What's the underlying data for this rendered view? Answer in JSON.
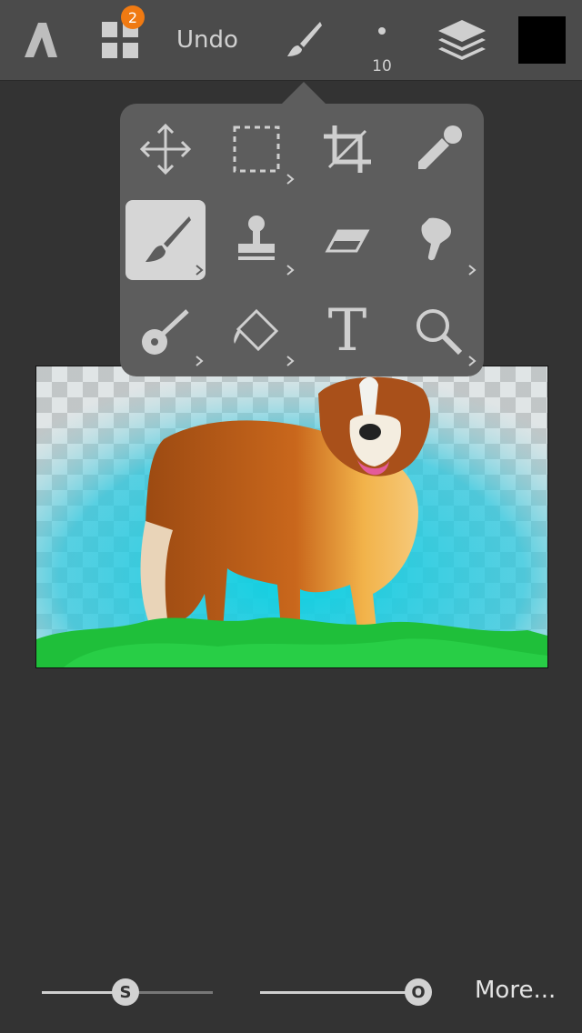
{
  "toolbar": {
    "layers_badge": "2",
    "undo_label": "Undo",
    "brush_size": "10",
    "current_color": "#000000",
    "icons": [
      "app-logo-icon",
      "grid-icon",
      "brush-icon",
      "layers-icon"
    ]
  },
  "tools_popup": {
    "tools": [
      {
        "name": "move",
        "icon": "move-icon",
        "has_submenu": false
      },
      {
        "name": "select",
        "icon": "selection-icon",
        "has_submenu": true
      },
      {
        "name": "crop",
        "icon": "crop-icon",
        "has_submenu": false
      },
      {
        "name": "eyedropper",
        "icon": "eyedropper-icon",
        "has_submenu": false
      },
      {
        "name": "brush",
        "icon": "brush-icon",
        "has_submenu": true,
        "selected": true
      },
      {
        "name": "stamp",
        "icon": "stamp-icon",
        "has_submenu": true
      },
      {
        "name": "eraser",
        "icon": "eraser-icon",
        "has_submenu": false
      },
      {
        "name": "smudge",
        "icon": "smudge-icon",
        "has_submenu": true
      },
      {
        "name": "gradient",
        "icon": "gradient-icon",
        "has_submenu": true
      },
      {
        "name": "fill",
        "icon": "fill-icon",
        "has_submenu": true
      },
      {
        "name": "text",
        "icon": "text-icon",
        "has_submenu": false
      },
      {
        "name": "zoom",
        "icon": "magnifier-icon",
        "has_submenu": true
      }
    ],
    "text_tool_glyph": "T"
  },
  "canvas": {
    "colors": {
      "sky_top": "#a9dbe3",
      "sky_bottom": "#0fd0e2",
      "grass": "#1fbf3a",
      "fur_dark": "#9c4a12",
      "fur_light": "#f2b34a"
    }
  },
  "bottom_bar": {
    "size_slider_label": "S",
    "size_value": 0.5,
    "opacity_slider_label": "O",
    "opacity_value": 1.0,
    "more_label": "More..."
  },
  "colors": {
    "toolbar_bg": "#4b4b4b",
    "popup_bg": "#5d5d5d",
    "badge": "#f07a12",
    "app_bg": "#333333"
  }
}
